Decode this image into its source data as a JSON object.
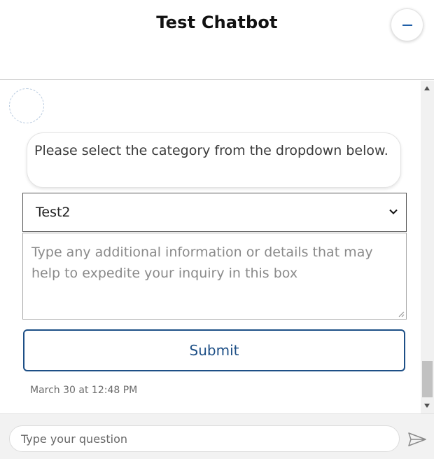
{
  "header": {
    "title": "Test Chatbot",
    "minimize_icon": "minimize-icon"
  },
  "chat": {
    "avatar_icon": "bot-avatar-icon",
    "bot_message": "Please select the category from the dropdown below.",
    "category_select": {
      "selected_value": "Test2",
      "icon": "chevron-down-icon"
    },
    "details_textarea": {
      "placeholder": "Type any additional information or details that may help to expedite your inquiry in this box"
    },
    "submit_label": "Submit",
    "timestamp": "March 30 at 12:48 PM"
  },
  "footer": {
    "question_placeholder": "Type your question",
    "send_icon": "send-icon"
  },
  "colors": {
    "accent": "#1d4f86",
    "minimize_accent": "#1f5fa8",
    "footer_bg": "#f2f2f2",
    "border": "#555555"
  }
}
